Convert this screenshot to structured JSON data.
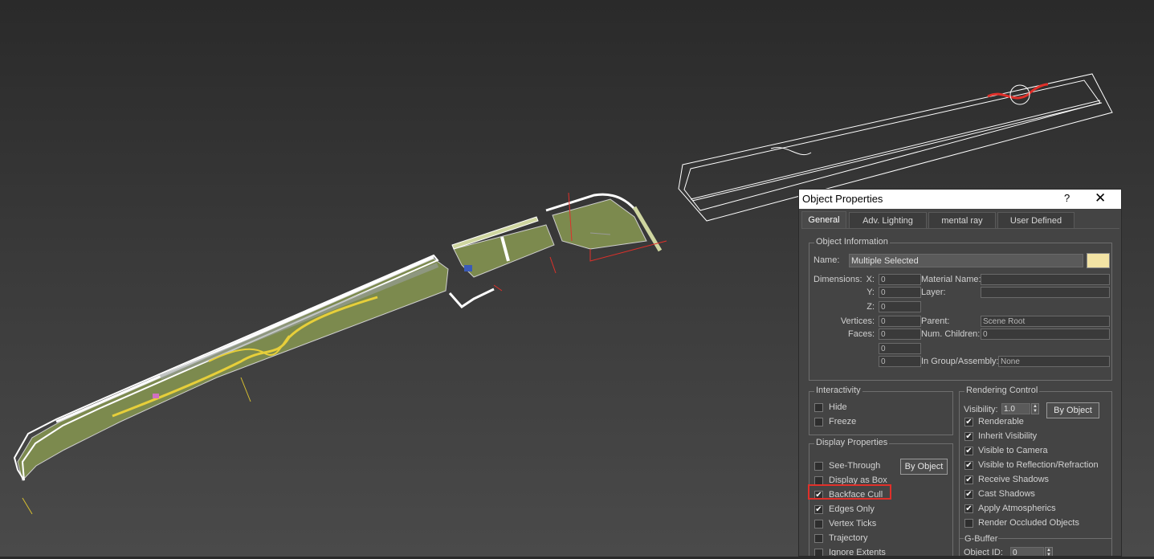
{
  "dialog": {
    "title": "Object Properties",
    "help": "?",
    "close": "✕",
    "tabs": [
      "General",
      "Adv. Lighting",
      "mental ray",
      "User Defined"
    ],
    "object_info": {
      "group_title": "Object Information",
      "name_label": "Name:",
      "name_value": "Multiple Selected",
      "color_swatch": "#f2e3a4",
      "dimensions_label": "Dimensions:",
      "x_label": "X:",
      "x_value": "0",
      "y_label": "Y:",
      "y_value": "0",
      "z_label": "Z:",
      "z_value": "0",
      "vertices_label": "Vertices:",
      "vertices_value": "0",
      "faces_label": "Faces:",
      "faces_value": "0",
      "extra1_value": "0",
      "extra2_value": "0",
      "material_label": "Material Name:",
      "material_value": "",
      "layer_label": "Layer:",
      "layer_value": "",
      "parent_label": "Parent:",
      "parent_value": "Scene Root",
      "children_label": "Num. Children:",
      "children_value": "0",
      "group_label": "In Group/Assembly:",
      "group_value": "None"
    },
    "interactivity": {
      "group_title": "Interactivity",
      "hide": "Hide",
      "hide_checked": false,
      "freeze": "Freeze",
      "freeze_checked": false
    },
    "display": {
      "group_title": "Display Properties",
      "by_object": "By Object",
      "items": [
        {
          "label": "See-Through",
          "checked": false
        },
        {
          "label": "Display as Box",
          "checked": false
        },
        {
          "label": "Backface Cull",
          "checked": true
        },
        {
          "label": "Edges Only",
          "checked": true
        },
        {
          "label": "Vertex Ticks",
          "checked": false
        },
        {
          "label": "Trajectory",
          "checked": false
        },
        {
          "label": "Ignore Extents",
          "checked": false
        }
      ]
    },
    "rendering": {
      "group_title": "Rendering Control",
      "visibility_label": "Visibility:",
      "visibility_value": "1.0",
      "by_object": "By Object",
      "items": [
        {
          "label": "Renderable",
          "checked": true
        },
        {
          "label": "Inherit Visibility",
          "checked": true
        },
        {
          "label": "Visible to Camera",
          "checked": true
        },
        {
          "label": "Visible to Reflection/Refraction",
          "checked": true
        },
        {
          "label": "Receive Shadows",
          "checked": true
        },
        {
          "label": "Cast Shadows",
          "checked": true
        },
        {
          "label": "Apply Atmospherics",
          "checked": true
        },
        {
          "label": "Render Occluded Objects",
          "checked": false
        }
      ]
    },
    "gbuffer": {
      "group_title": "G-Buffer",
      "object_id_label": "Object ID:",
      "object_id_value": "0"
    }
  },
  "colors": {
    "viewport_top": "#2a2a2a",
    "viewport_bottom": "#4a4a4a",
    "terrain": "#7c8a4e",
    "path_yellow": "#e7cf3a",
    "highlight_red": "#e0302a"
  }
}
